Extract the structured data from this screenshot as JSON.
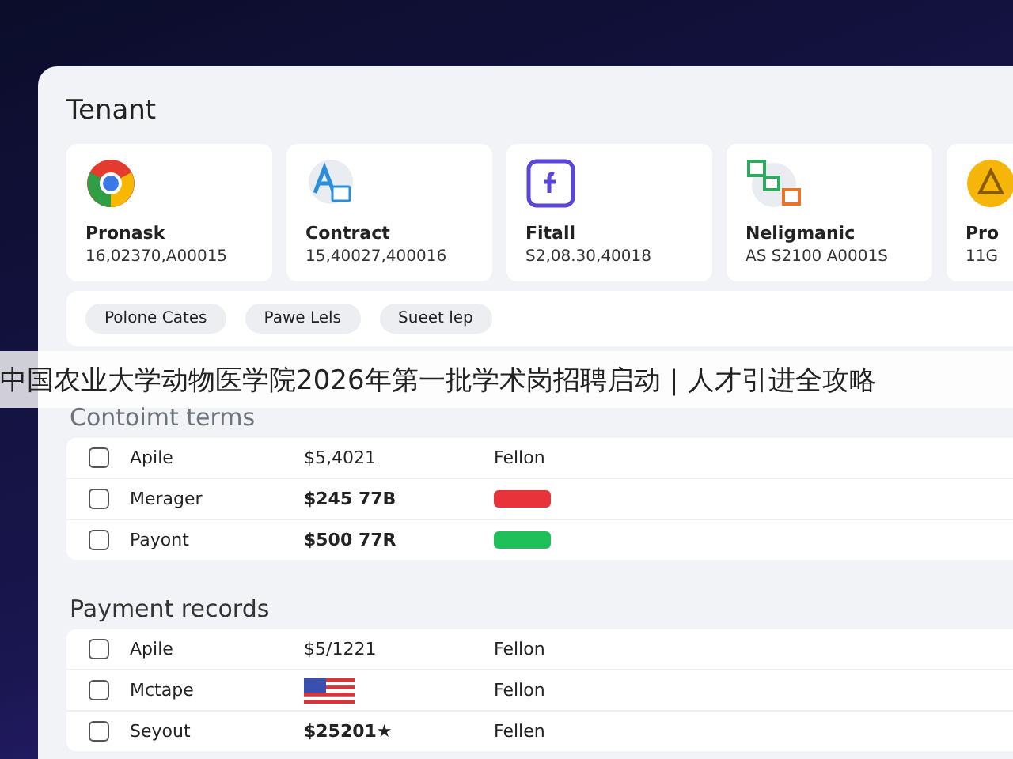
{
  "panel": {
    "title": "Tenant"
  },
  "cards": [
    {
      "kind": "ring",
      "name": "Pronask",
      "value": "16,02370,A00015"
    },
    {
      "kind": "letter_tile",
      "name": "Contract",
      "value": "15,40027,400016"
    },
    {
      "kind": "square",
      "name": "Fitall",
      "value": "S2,08.30,40018"
    },
    {
      "kind": "tiles",
      "name": "Neligmanic",
      "value": "AS S2100 A0001S"
    },
    {
      "kind": "coin",
      "name": "Pro",
      "value": "11G"
    }
  ],
  "chips": [
    "Polone Cates",
    "Pawe Lels",
    "Sueet lep"
  ],
  "banner": {
    "text": "中国农业大学动物医学院2026年第一批学术岗招聘启动｜人才引进全攻略"
  },
  "sections": [
    {
      "title": "Contoimt terms",
      "rows": [
        {
          "checked": false,
          "name": "Apile",
          "amount": {
            "kind": "text",
            "text": "$5,4021",
            "bold": false
          },
          "status": {
            "kind": "text",
            "text": "Fellon"
          }
        },
        {
          "checked": false,
          "name": "Merager",
          "amount": {
            "kind": "text",
            "text": "$245 77B",
            "bold": true
          },
          "status": {
            "kind": "badge",
            "color": "#e8333a"
          }
        },
        {
          "checked": false,
          "name": "Payont",
          "amount": {
            "kind": "text",
            "text": "$500 77R",
            "bold": true
          },
          "status": {
            "kind": "badge",
            "color": "#1fbf5a"
          }
        }
      ]
    },
    {
      "title": "Payment records",
      "rows": [
        {
          "checked": false,
          "name": "Apile",
          "amount": {
            "kind": "text",
            "text": "$5/1221",
            "bold": false
          },
          "status": {
            "kind": "text",
            "text": "Fellon"
          }
        },
        {
          "checked": false,
          "name": "Mctape",
          "amount": {
            "kind": "flag"
          },
          "status": {
            "kind": "text",
            "text": "Fellon"
          }
        },
        {
          "checked": false,
          "name": "Seyout",
          "amount": {
            "kind": "text",
            "text": "$25201★",
            "bold": true
          },
          "status": {
            "kind": "text",
            "text": "Fellen"
          }
        }
      ]
    }
  ]
}
